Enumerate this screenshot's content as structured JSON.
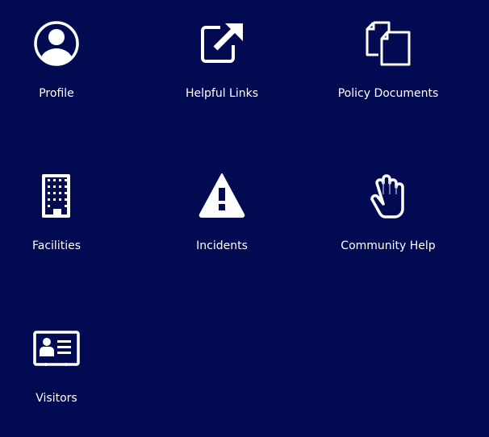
{
  "background": "#020b52",
  "icon_color": "#ffffff",
  "tiles": [
    {
      "label": "Profile",
      "icon": "user-circle-icon"
    },
    {
      "label": "Helpful Links",
      "icon": "external-link-icon"
    },
    {
      "label": "Policy Documents",
      "icon": "documents-icon"
    },
    {
      "label": "Facilities",
      "icon": "building-icon"
    },
    {
      "label": "Incidents",
      "icon": "warning-icon"
    },
    {
      "label": "Community Help",
      "icon": "hand-icon"
    },
    {
      "label": "Visitors",
      "icon": "id-card-icon"
    }
  ]
}
